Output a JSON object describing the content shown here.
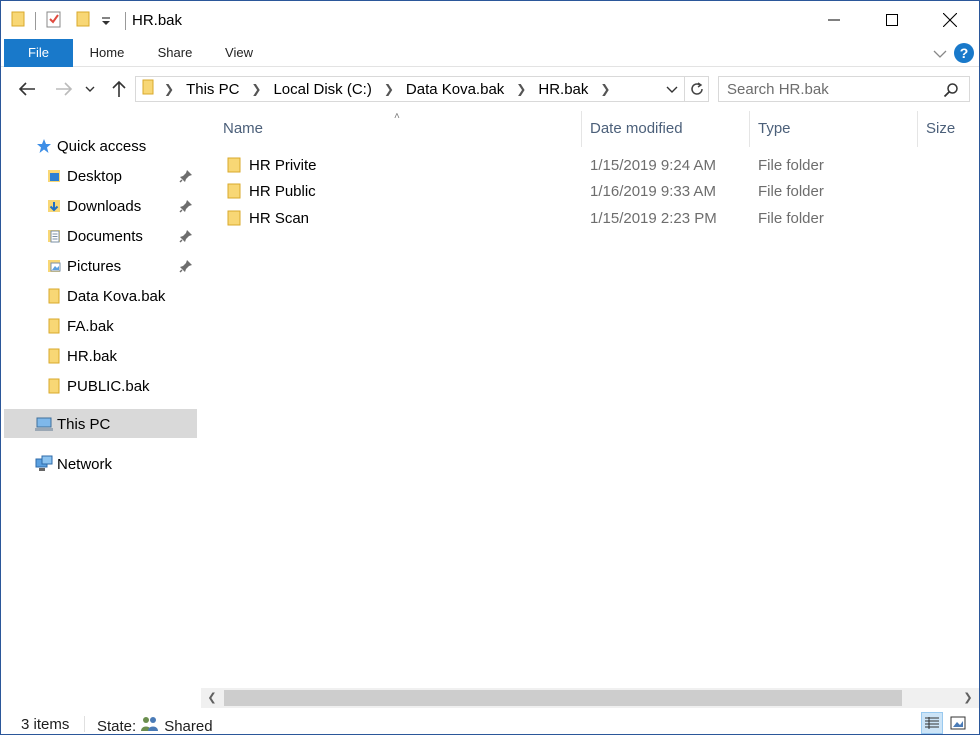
{
  "window": {
    "title": "HR.bak",
    "minimize_icon": "minimize-icon",
    "maximize_icon": "maximize-icon",
    "close_icon": "close-icon"
  },
  "ribbon": {
    "tabs": [
      "File",
      "Home",
      "Share",
      "View"
    ],
    "help": "?"
  },
  "address": {
    "crumbs": [
      "This PC",
      "Local Disk (C:)",
      "Data Kova.bak",
      "HR.bak"
    ],
    "search_placeholder": "Search HR.bak"
  },
  "sidebar": {
    "quick_access": "Quick access",
    "items": [
      {
        "label": "Desktop",
        "icon": "desktop-folder-icon",
        "pinned": true
      },
      {
        "label": "Downloads",
        "icon": "downloads-folder-icon",
        "pinned": true
      },
      {
        "label": "Documents",
        "icon": "documents-folder-icon",
        "pinned": true
      },
      {
        "label": "Pictures",
        "icon": "pictures-folder-icon",
        "pinned": true
      },
      {
        "label": "Data Kova.bak",
        "icon": "folder-icon",
        "pinned": false
      },
      {
        "label": "FA.bak",
        "icon": "folder-icon",
        "pinned": false
      },
      {
        "label": "HR.bak",
        "icon": "folder-icon",
        "pinned": false
      },
      {
        "label": "PUBLIC.bak",
        "icon": "folder-icon",
        "pinned": false
      }
    ],
    "this_pc": "This PC",
    "network": "Network"
  },
  "columns": {
    "name": "Name",
    "date": "Date modified",
    "type": "Type",
    "size": "Size"
  },
  "files": [
    {
      "name": "HR Privite",
      "date": "1/15/2019 9:24 AM",
      "type": "File folder"
    },
    {
      "name": "HR Public",
      "date": "1/16/2019 9:33 AM",
      "type": "File folder"
    },
    {
      "name": "HR Scan",
      "date": "1/15/2019 2:23 PM",
      "type": "File folder"
    }
  ],
  "status": {
    "items": "3 items",
    "state_label": "State:",
    "state_value": "Shared"
  },
  "colors": {
    "accent": "#1979ca",
    "folder": "#f8d775",
    "header_text": "#4c607a",
    "selected": "#d9d9d9"
  }
}
